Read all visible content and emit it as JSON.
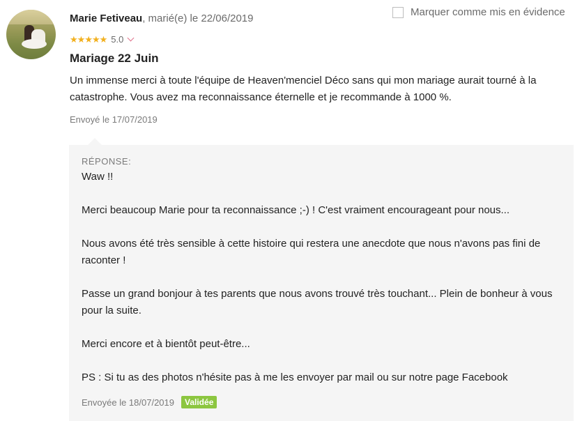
{
  "review": {
    "author": "Marie Fetiveau",
    "married_text": ", marié(e) le 22/06/2019",
    "rating_value": "5.0",
    "rating_stars": 5,
    "title": "Mariage 22 Juin",
    "body": "Un immense merci à toute l'équipe de Heaven'menciel Déco sans qui mon mariage aurait tourné à la catastrophe. Vous avez ma reconnaissance éternelle et je recommande à 1000 %.",
    "sent": "Envoyé le 17/07/2019",
    "highlight_label": "Marquer comme mis en évidence",
    "highlight_checked": false
  },
  "reply": {
    "label": "RÉPONSE:",
    "paragraphs": [
      "Waw !!",
      "Merci beaucoup Marie pour ta reconnaissance ;-) ! C'est vraiment encourageant pour nous...",
      "Nous avons été très sensible à cette histoire qui restera une anecdote que nous n'avons pas fini de raconter !",
      "Passe un grand bonjour à tes parents que nous avons trouvé très touchant... Plein de bonheur à vous pour la suite.",
      "Merci encore et à bientôt peut-être...",
      "PS : Si tu as des photos n'hésite pas à me les envoyer par mail ou sur notre page Facebook"
    ],
    "sent": "Envoyée le 18/07/2019",
    "status_badge": "Validée"
  },
  "colors": {
    "star": "#f2b01e",
    "badge": "#8cc640",
    "chevron": "#e0718a",
    "reply_bg": "#f5f5f5"
  },
  "icons": {
    "star": "star-icon",
    "chevron": "chevron-down-icon",
    "checkbox": "checkbox-icon"
  }
}
